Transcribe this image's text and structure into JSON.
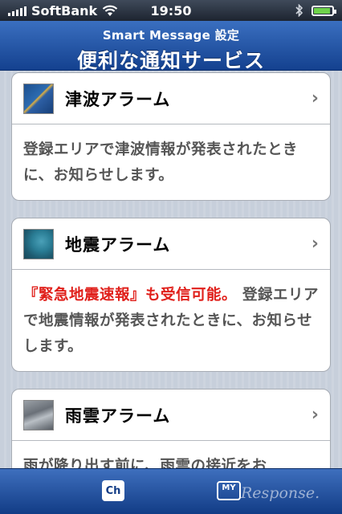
{
  "status_bar": {
    "carrier": "SoftBank",
    "time": "19:50",
    "battery_level": 0.9
  },
  "nav": {
    "subtitle": "Smart Message 設定",
    "title": "便利な通知サービス"
  },
  "cards": [
    {
      "icon": "tsunami-map-icon",
      "title": "津波アラーム",
      "body_plain": "登録エリアで津波情報が発表されたときに、お知らせします。"
    },
    {
      "icon": "earthquake-map-icon",
      "title": "地震アラーム",
      "body_highlight": "『緊急地震速報』も受信可能。",
      "body_plain": "登録エリアで地震情報が発表されたときに、お知らせします。"
    },
    {
      "icon": "rain-cloud-map-icon",
      "title": "雨雲アラーム",
      "body_plain": "雨が降り出す前に、雨雲の接近をお"
    }
  ],
  "tabbar": {
    "ch_label": "Ch",
    "my_label": "MY"
  },
  "watermark": "Response."
}
